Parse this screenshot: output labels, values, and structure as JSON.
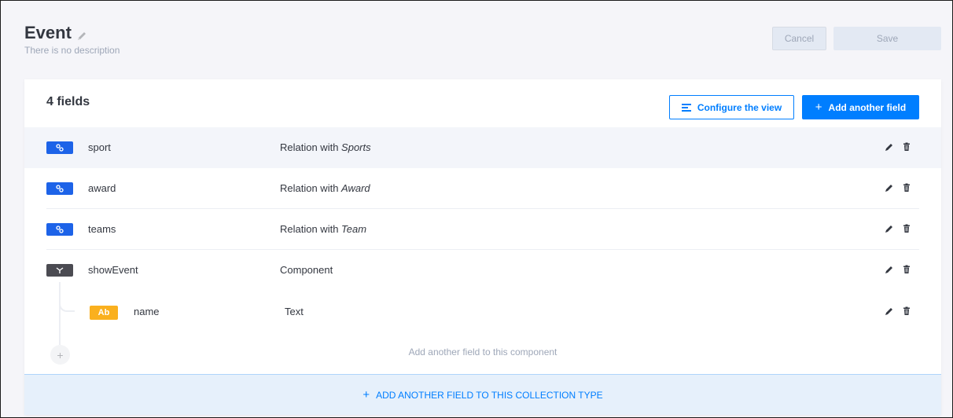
{
  "header": {
    "title": "Event",
    "description": "There is no description",
    "cancel_label": "Cancel",
    "save_label": "Save"
  },
  "card": {
    "fields_count": "4 fields",
    "configure_label": "Configure the view",
    "add_field_label": "Add another field",
    "add_to_component_label": "Add another field to this component",
    "add_to_collection_label": "ADD ANOTHER FIELD TO THIS COLLECTION TYPE"
  },
  "fields": [
    {
      "name": "sport",
      "type_prefix": "Relation with ",
      "type_target": "Sports",
      "icon": "link-icon"
    },
    {
      "name": "award",
      "type_prefix": "Relation with ",
      "type_target": "Award",
      "icon": "link-icon"
    },
    {
      "name": "teams",
      "type_prefix": "Relation with ",
      "type_target": "Team",
      "icon": "link-icon"
    },
    {
      "name": "showEvent",
      "type_prefix": "Component",
      "type_target": "",
      "icon": "component-icon"
    }
  ],
  "component_fields": [
    {
      "name": "name",
      "type": "Text",
      "badge": "Ab"
    }
  ],
  "colors": {
    "primary": "#007eff",
    "relation_badge": "#1d63e8",
    "component_badge": "#4b4b52",
    "text_badge": "#fab01e"
  }
}
